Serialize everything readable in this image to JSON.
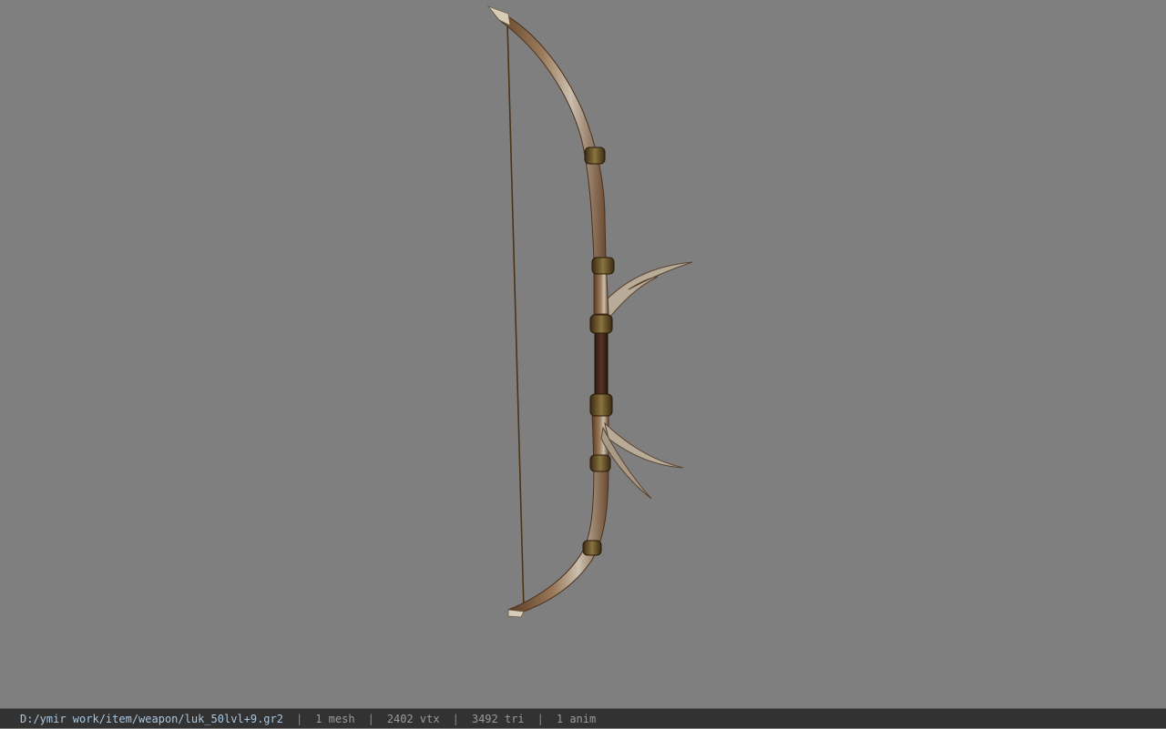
{
  "viewer": {
    "background_color": "#7f7f7f",
    "model_icon": "bow-model"
  },
  "status": {
    "file_path": "D:/ymir work/item/weapon/luk_50lvl+9.gr2",
    "separator": "|",
    "mesh_count": "1 mesh",
    "vertex_count": "2402 vtx",
    "triangle_count": "3492 tri",
    "anim_count": "1 anim"
  }
}
